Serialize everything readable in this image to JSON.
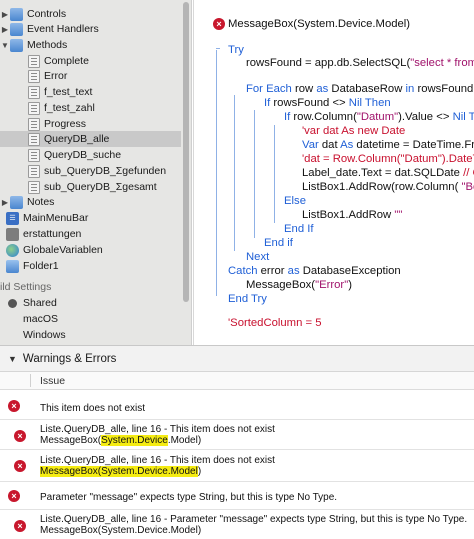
{
  "navigator": {
    "items": [
      {
        "label": "Controls",
        "disclosure": "right",
        "icon": "folder-icon"
      },
      {
        "label": "Event Handlers",
        "disclosure": "right",
        "icon": "folder-icon"
      },
      {
        "label": "Methods",
        "disclosure": "down",
        "icon": "folder-icon"
      },
      {
        "label": "Complete",
        "icon": "method-icon"
      },
      {
        "label": "Error",
        "icon": "method-icon"
      },
      {
        "label": "f_test_text",
        "icon": "method-icon"
      },
      {
        "label": "f_test_zahl",
        "icon": "method-icon"
      },
      {
        "label": "Progress",
        "icon": "method-icon"
      },
      {
        "label": "QueryDB_alle",
        "icon": "method-icon",
        "selected": true
      },
      {
        "label": "QueryDB_suche",
        "icon": "method-icon"
      },
      {
        "label": "sub_QueryDB_Σgefunden",
        "icon": "method-icon"
      },
      {
        "label": "sub_QueryDB_Σgesamt",
        "icon": "method-icon"
      },
      {
        "label": "Notes",
        "disclosure": "right",
        "icon": "folder-icon"
      },
      {
        "label": "MainMenuBar",
        "icon": "menubar-icon"
      },
      {
        "label": "erstattungen",
        "icon": "database-icon"
      },
      {
        "label": "GlobaleVariablen",
        "icon": "module-icon"
      },
      {
        "label": "Folder1",
        "icon": "folder-icon"
      }
    ],
    "build_settings_label": "ild Settings",
    "build_targets": [
      {
        "label": "Shared",
        "selected": true
      },
      {
        "label": "macOS",
        "selected": false
      },
      {
        "label": "Windows",
        "selected": false
      }
    ]
  },
  "code": {
    "lines": [
      "MessageBox(System.Device.Model)",
      "Try",
      "rowsFound = app.db.SelectSQL(\"select * from",
      "For Each row as DatabaseRow in rowsFound",
      "If rowsFound <> Nil Then",
      "If row.Column(\"Datum\").Value <> Nil T",
      "'var dat As new Date",
      "Var dat As datetime = DateTime.Fr",
      "'dat = Row.Column(\"Datum\").DateT",
      "Label_date.Text = dat.SQLDate // C",
      "ListBox1.AddRow(row.Column( \"Be",
      "Else",
      "ListBox1.AddRow \"\"",
      "End If",
      "End if",
      "Next",
      "Catch error as DatabaseException",
      "MessageBox(\"Error\")",
      "End Try",
      "'SortedColumn = 5"
    ]
  },
  "warnings": {
    "title": "Warnings & Errors",
    "column_issue": "Issue",
    "rows": [
      {
        "line1": "This item does not exist",
        "line2": "",
        "highlight": ""
      },
      {
        "line1": "Liste.QueryDB_alle, line 16 - This item does not exist",
        "line2_pre": "MessageBox(",
        "line2_hl": "System.Device",
        "line2_post": ".Model)"
      },
      {
        "line1": "Liste.QueryDB_alle, line 16 - This item does not exist",
        "line2_pre": "",
        "line2_hl": "MessageBox(System.Device.Model",
        "line2_post": ")"
      },
      {
        "line1": "Parameter \"message\" expects type String, but this is type No Type.",
        "line2": ""
      },
      {
        "line1": "Liste.QueryDB_alle, line 16 - Parameter \"message\" expects type String, but this is type No Type.",
        "line2_pre": "MessageBox(System.Device.Model)",
        "line2_hl": "",
        "line2_post": ""
      }
    ]
  },
  "colors": {
    "keyword": "#1f5fd6",
    "string": "#a0136b",
    "comment": "#c8102e",
    "error": "#c8172d",
    "highlight": "#f5ec13"
  }
}
